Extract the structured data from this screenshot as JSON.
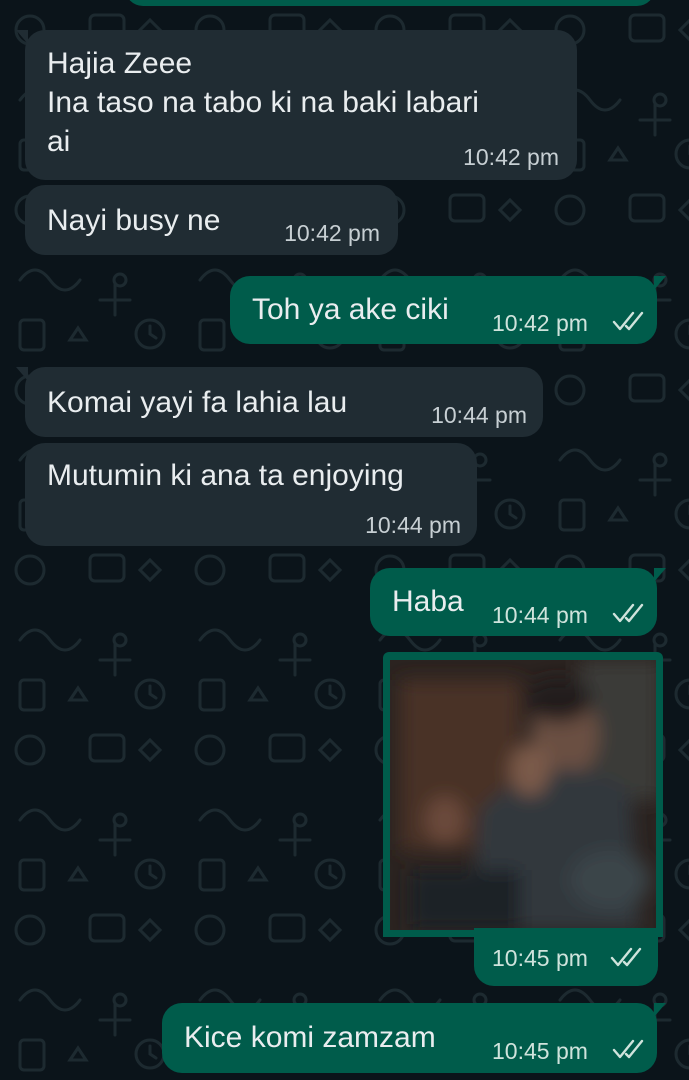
{
  "colors": {
    "background": "#0b141a",
    "incoming_bubble": "#202c33",
    "outgoing_bubble": "#005c4b",
    "read_ticks": "#cfe3dc"
  },
  "messages": [
    {
      "direction": "in",
      "text": "Hajia Zeee\nIna taso na tabo ki na baki labari\nai",
      "time": "10:42 pm"
    },
    {
      "direction": "in",
      "text": "Nayi busy ne",
      "time": "10:42 pm"
    },
    {
      "direction": "out",
      "text": "Toh ya ake ciki",
      "time": "10:42 pm",
      "status": "read"
    },
    {
      "direction": "in",
      "text": "Komai yayi fa lahia lau",
      "time": "10:44 pm"
    },
    {
      "direction": "in",
      "text": "Mutumin ki ana ta enjoying",
      "time": "10:44 pm"
    },
    {
      "direction": "out",
      "text": "Haba",
      "time": "10:44 pm",
      "status": "read"
    },
    {
      "direction": "out",
      "type": "image",
      "image_description": "blurred-photo-of-person",
      "time": "10:45 pm",
      "status": "read"
    },
    {
      "direction": "out",
      "text": "Kice komi zamzam",
      "time": "10:45 pm",
      "status": "read"
    }
  ],
  "icons": {
    "read_receipt": "double-check-icon",
    "wallpaper": "chat-doodle-pattern"
  }
}
